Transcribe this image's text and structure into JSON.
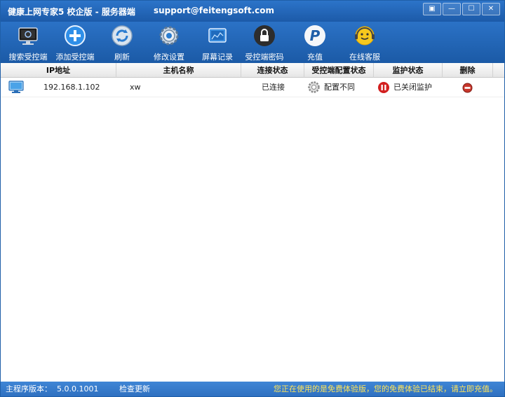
{
  "window": {
    "title": "健康上网专家5 校企版 - 服务器端",
    "email": "support@feitengsoft.com",
    "controls": {
      "menu": "▣",
      "minimize": "—",
      "maximize": "☐",
      "close": "✕"
    }
  },
  "toolbar": {
    "items": [
      {
        "label": "搜索受控端",
        "icon": "monitor-search-icon"
      },
      {
        "label": "添加受控端",
        "icon": "add-circle-icon"
      },
      {
        "label": "刷新",
        "icon": "refresh-icon"
      },
      {
        "label": "修改设置",
        "icon": "gear-icon"
      },
      {
        "label": "屏幕记录",
        "icon": "screen-record-icon"
      },
      {
        "label": "受控端密码",
        "icon": "lock-icon"
      },
      {
        "label": "充值",
        "icon": "paypal-icon"
      },
      {
        "label": "在线客服",
        "icon": "support-headset-icon"
      }
    ]
  },
  "table": {
    "columns": [
      "IP地址",
      "主机名称",
      "连接状态",
      "受控端配置状态",
      "监护状态",
      "删除"
    ],
    "rows": [
      {
        "ip": "192.168.1.102",
        "host": "xw",
        "connection": "已连接",
        "config": "配置不同",
        "monitor": "已关闭监护",
        "delete_icon": "delete-icon"
      }
    ]
  },
  "statusbar": {
    "version_label": "主程序版本：",
    "version": "5.0.0.1001",
    "check_update": "检查更新",
    "warning": "您正在使用的是免费体验版，您的免费体验已结束，请立即充值。"
  },
  "colors": {
    "titlebar": "#2469be",
    "toolbar": "#1f5eaa",
    "statusbar": "#3a7fd0",
    "warning": "#ffe45a",
    "stop": "#d21f1f"
  }
}
